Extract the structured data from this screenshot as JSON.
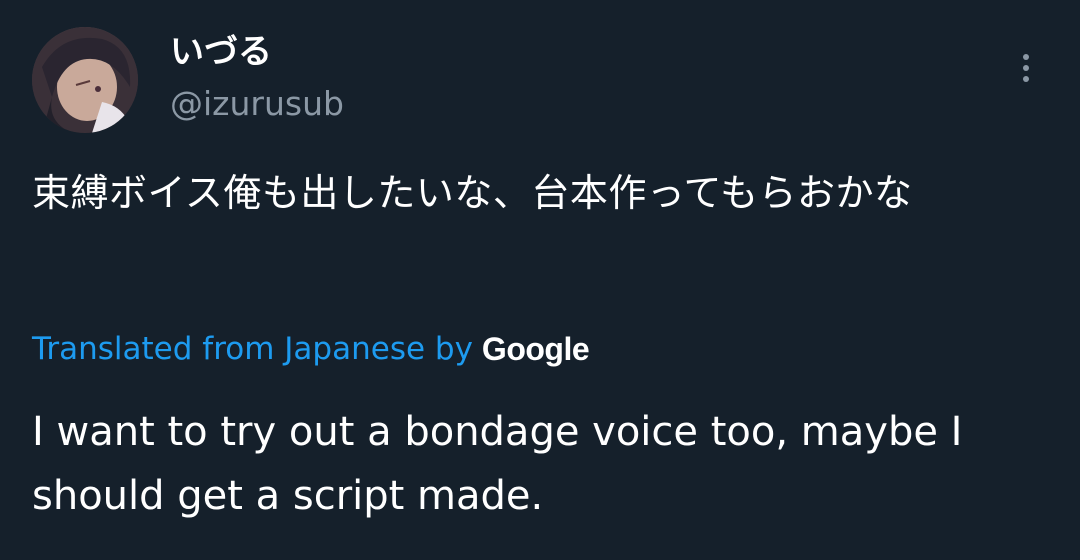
{
  "user": {
    "display_name": "いづる",
    "handle": "@izurusub"
  },
  "tweet": {
    "text": "束縛ボイス俺も出したいな、台本作ってもらおかな"
  },
  "translation": {
    "attribution": "Translated from Japanese by",
    "provider": "Google",
    "text": "I want to try out a bondage voice too, maybe I should get a script made."
  },
  "colors": {
    "background": "#15202b",
    "link": "#1d9bf0",
    "secondary_text": "#8b98a5",
    "primary_text": "#ffffff"
  },
  "icons": {
    "more": "more-vertical-icon"
  }
}
